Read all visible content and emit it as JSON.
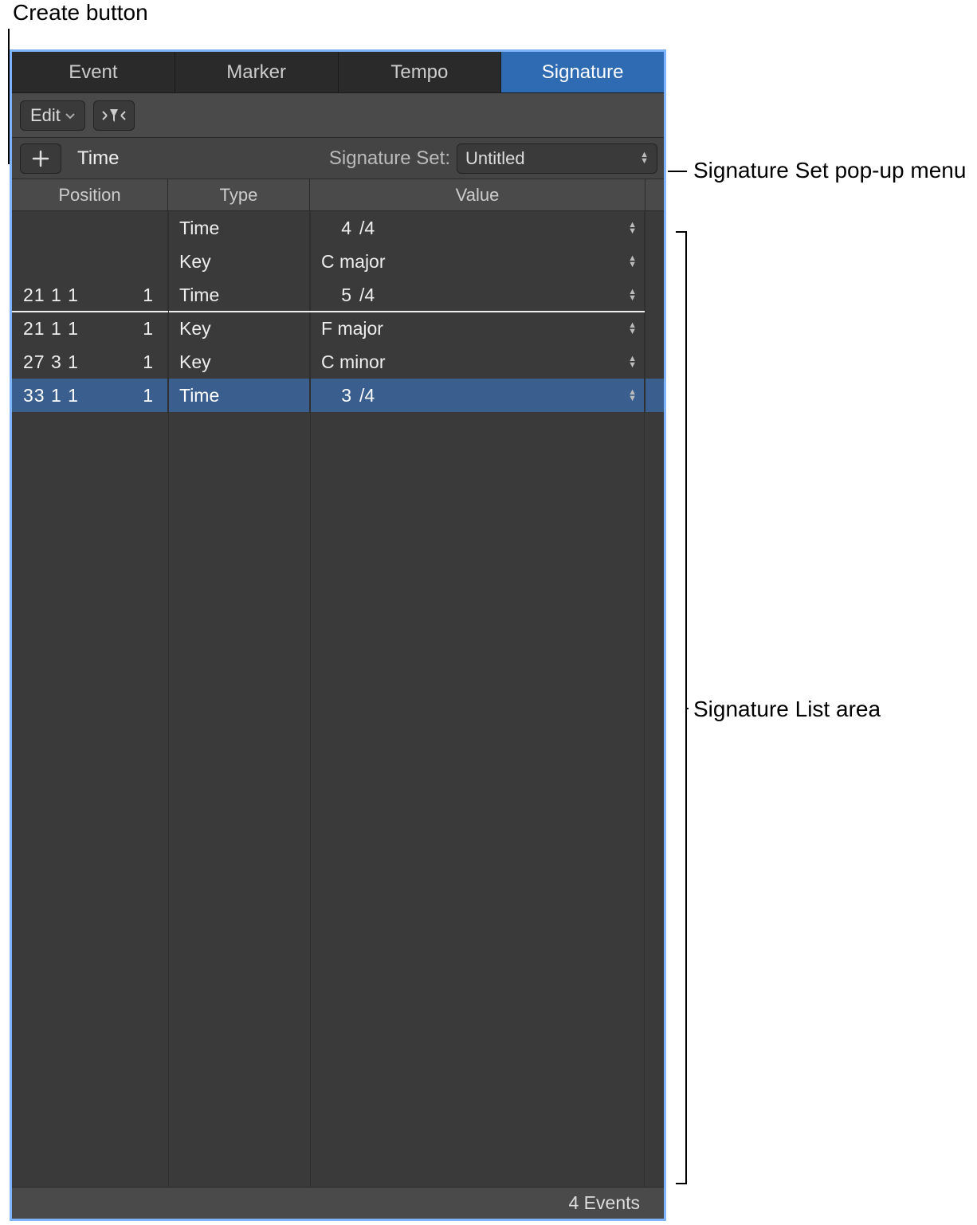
{
  "callouts": {
    "create_button": "Create button",
    "sigset_popup": "Signature Set pop-up menu",
    "list_area": "Signature List area"
  },
  "tabs": {
    "event": "Event",
    "marker": "Marker",
    "tempo": "Tempo",
    "signature": "Signature",
    "active": "signature"
  },
  "toolbar": {
    "edit_label": "Edit"
  },
  "createRow": {
    "type_label": "Time",
    "sigset_label": "Signature Set:",
    "sigset_value": "Untitled"
  },
  "columns": {
    "position": "Position",
    "type": "Type",
    "value": "Value"
  },
  "rows": [
    {
      "position": "",
      "sub": "",
      "type": "Time",
      "value_kind": "time",
      "num": "4",
      "den": "/4",
      "selected": false
    },
    {
      "position": "",
      "sub": "",
      "type": "Key",
      "value_kind": "key",
      "text": "C major",
      "selected": false
    },
    {
      "position": "21 1 1",
      "sub": "1",
      "type": "Time",
      "value_kind": "time",
      "num": "5",
      "den": "/4",
      "selected": false,
      "hline_after": true
    },
    {
      "position": "21 1 1",
      "sub": "1",
      "type": "Key",
      "value_kind": "key",
      "text": "F major",
      "selected": false
    },
    {
      "position": "27 3 1",
      "sub": "1",
      "type": "Key",
      "value_kind": "key",
      "text": "C minor",
      "selected": false
    },
    {
      "position": "33 1 1",
      "sub": "1",
      "type": "Time",
      "value_kind": "time",
      "num": "3",
      "den": "/4",
      "selected": true
    }
  ],
  "status": {
    "text": "4 Events"
  }
}
